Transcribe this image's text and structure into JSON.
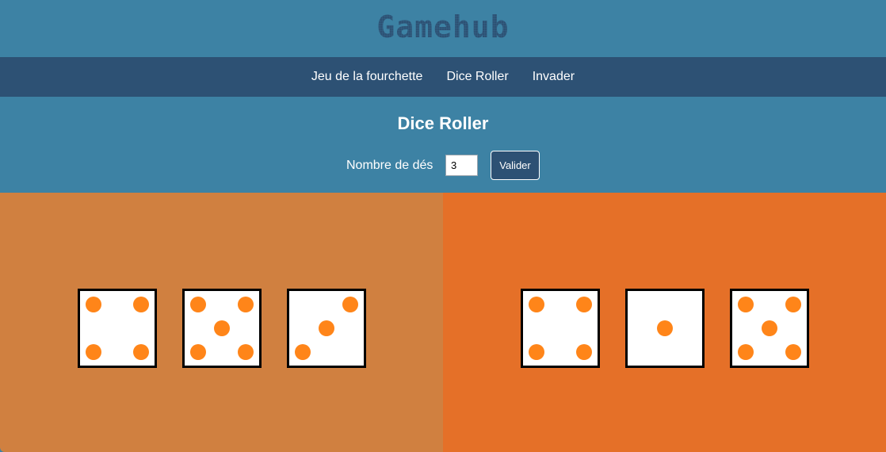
{
  "header": {
    "logo_text": "Gamehub",
    "logo_color": "#2d5174"
  },
  "nav": {
    "items": [
      {
        "label": "Jeu de la fourchette"
      },
      {
        "label": "Dice Roller"
      },
      {
        "label": "Invader"
      }
    ]
  },
  "page": {
    "title": "Dice Roller"
  },
  "form": {
    "count_label": "Nombre de dés",
    "count_value": "3",
    "submit_label": "Valider"
  },
  "colors": {
    "header_bg": "#3d82a4",
    "nav_bg": "#2d5174",
    "player_left_bg": "#d08040",
    "player_right_bg": "#e57028",
    "pip": "#ff8519"
  },
  "players": [
    {
      "dice": [
        4,
        5,
        3
      ]
    },
    {
      "dice": [
        4,
        1,
        5
      ]
    }
  ]
}
